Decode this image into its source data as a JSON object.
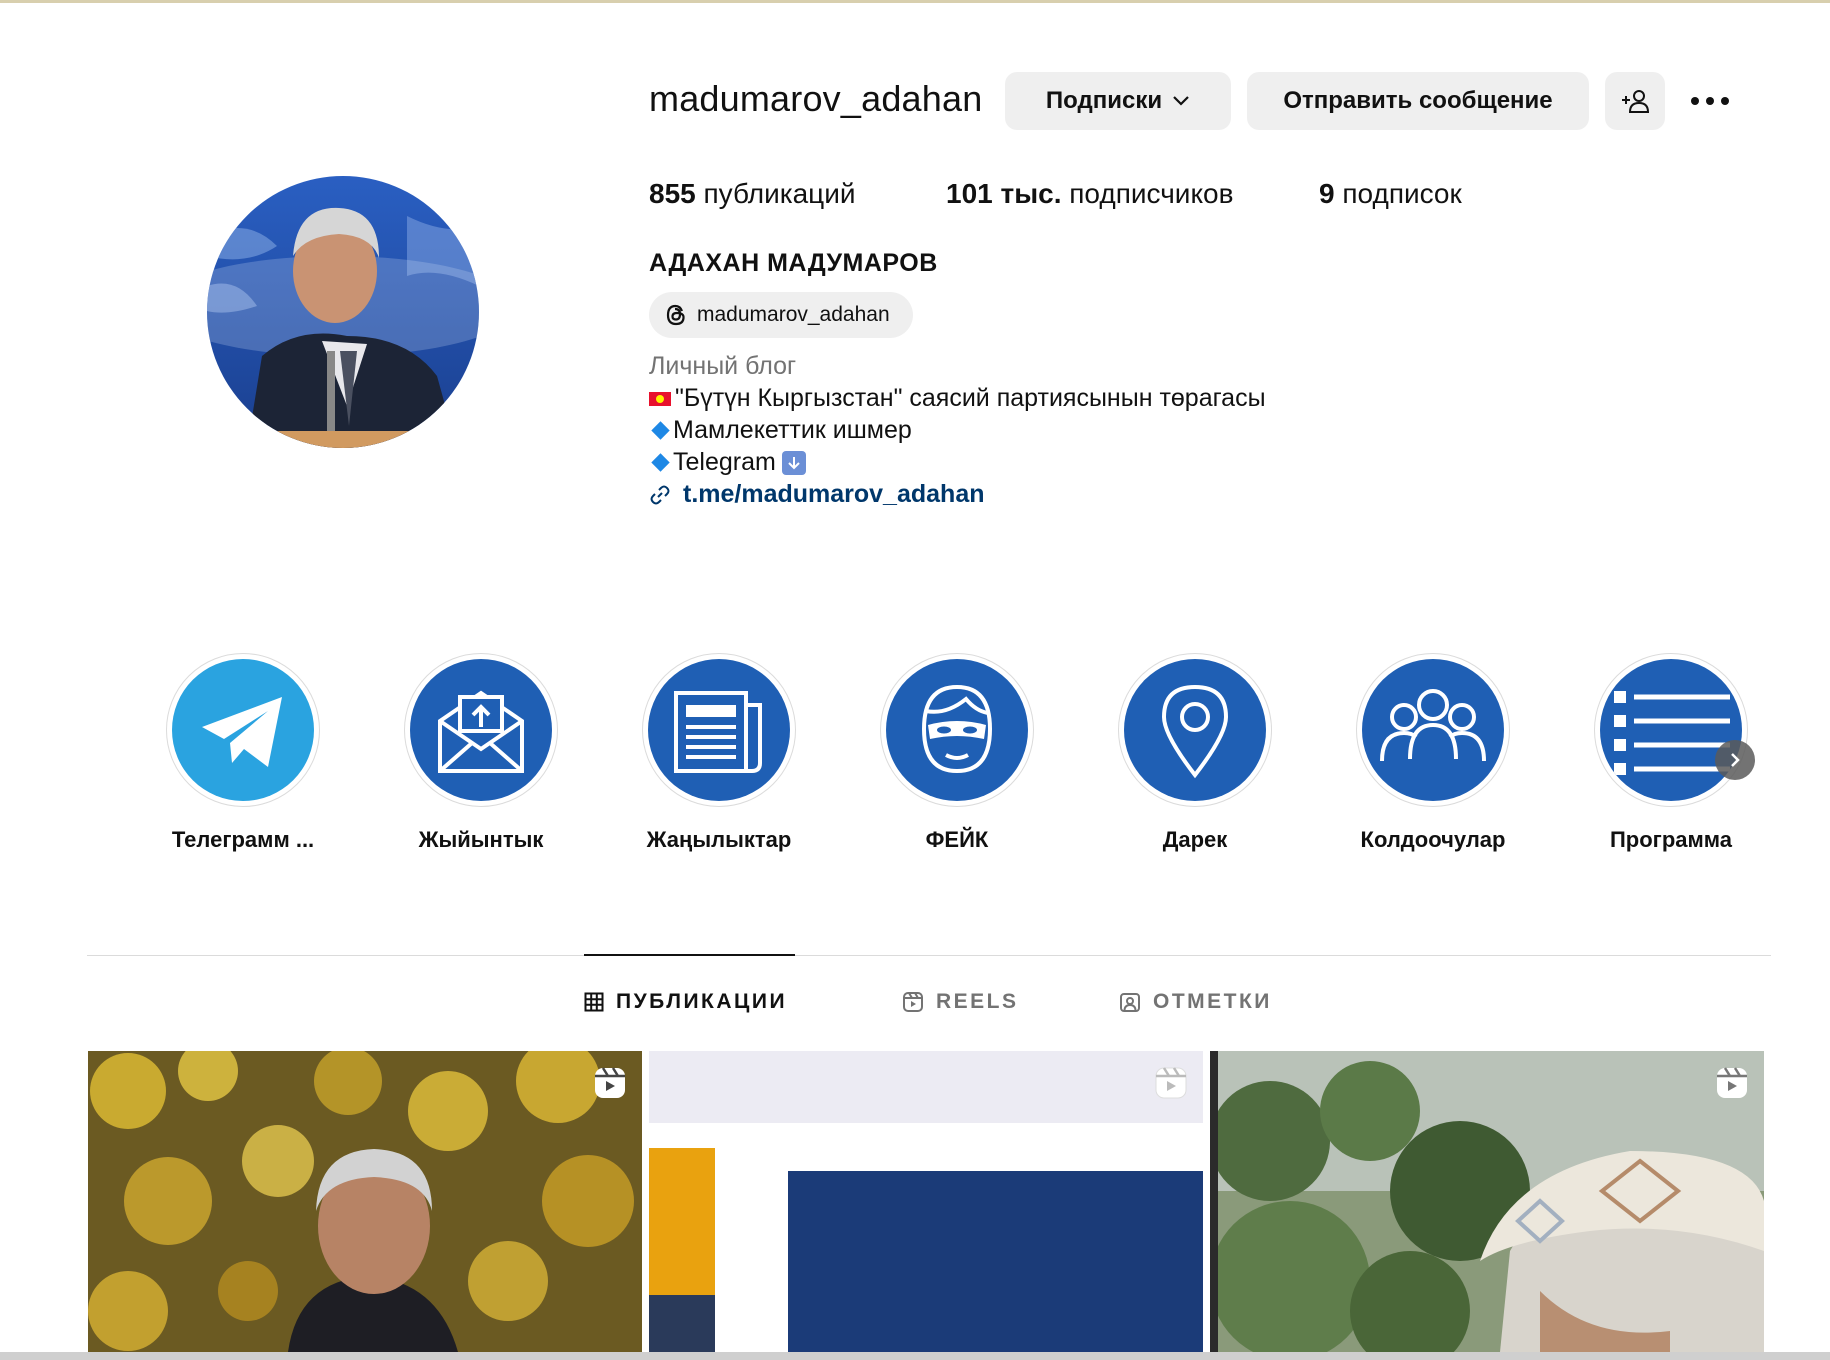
{
  "profile": {
    "username": "madumarov_adahan",
    "following_button": "Подписки",
    "message_button": "Отправить сообщение",
    "stats": {
      "posts_count": "855",
      "posts_label": "публикаций",
      "followers_count": "101 тыс.",
      "followers_label": "подписчиков",
      "following_count": "9",
      "following_label": "подписок"
    },
    "full_name": "АДАХАН МАДУМАРОВ",
    "threads_handle": "madumarov_adahan",
    "category": "Личный блог",
    "bio_lines": [
      "\"Бүтүн Кыргызстан\" саясий партиясынын төрагасы",
      "Мамлекеттик ишмер",
      "Telegram"
    ],
    "link": "t.me/madumarov_adahan"
  },
  "highlights": [
    {
      "label": "Телеграмм ...",
      "icon": "telegram-icon"
    },
    {
      "label": "Жыйынтык",
      "icon": "envelope-icon"
    },
    {
      "label": "Жаңылыктар",
      "icon": "newspaper-icon"
    },
    {
      "label": "ФЕЙК",
      "icon": "masked-face-icon"
    },
    {
      "label": "Дарек",
      "icon": "location-pin-icon"
    },
    {
      "label": "Колдоочулар",
      "icon": "group-icon"
    },
    {
      "label": "Программа",
      "icon": "list-icon"
    }
  ],
  "tabs": [
    {
      "label": "ПУБЛИКАЦИИ",
      "active": true
    },
    {
      "label": "REELS",
      "active": false
    },
    {
      "label": "ОТМЕТКИ",
      "active": false
    }
  ],
  "colors": {
    "link": "#00376b",
    "highlight_blue": "#1f5fb4",
    "telegram_blue": "#2aa3e0",
    "button_bg": "#efefef"
  }
}
